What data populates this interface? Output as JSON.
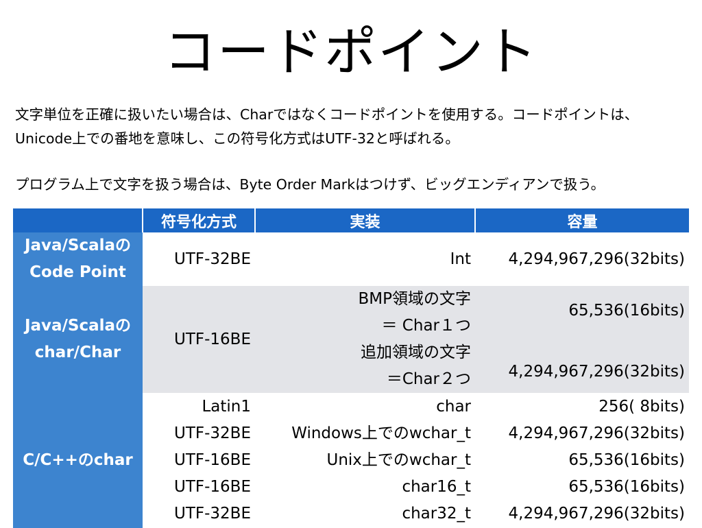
{
  "title": "コードポイント",
  "paragraphs": [
    "文字単位を正確に扱いたい場合は、Charではなくコードポイントを使用する。コードポイントは、Unicode上での番地を意味し、この符号化方式はUTF-32と呼ばれる。",
    "プログラム上で文字を扱う場合は、Byte Order Markはつけず、ビッグエンディアンで扱う。"
  ],
  "table": {
    "headers": [
      "",
      "符号化方式",
      "実装",
      "容量"
    ],
    "rows": [
      {
        "label": [
          "Java/Scalaの",
          "Code Point"
        ],
        "formats": [
          "UTF-32BE"
        ],
        "impl": [
          "Int"
        ],
        "capacity": [
          "4,294,967,296(32bits)"
        ]
      },
      {
        "label": [
          "Java/Scalaの",
          "char/Char"
        ],
        "formats": [
          "UTF-16BE"
        ],
        "impl": [
          "BMP領域の文字",
          "＝ Char１つ",
          "追加領域の文字",
          "＝Char２つ"
        ],
        "capacity": [
          "65,536(16bits)",
          "4,294,967,296(32bits)"
        ]
      },
      {
        "label": [
          "C/C++のchar"
        ],
        "formats": [
          "Latin1",
          "UTF-32BE",
          "UTF-16BE",
          "UTF-16BE",
          "UTF-32BE"
        ],
        "impl": [
          "char",
          "Windows上でのwchar_t",
          "Unix上でのwchar_t",
          "char16_t",
          "char32_t"
        ],
        "capacity": [
          "256( 8bits)",
          "4,294,967,296(32bits)",
          "65,536(16bits)",
          "65,536(16bits)",
          "4,294,967,296(32bits)"
        ]
      }
    ]
  },
  "colors": {
    "header_bg": "#1b67c5",
    "rowhead_bg": "#3d84cf",
    "alt_row_bg": "#e3e4e8"
  }
}
